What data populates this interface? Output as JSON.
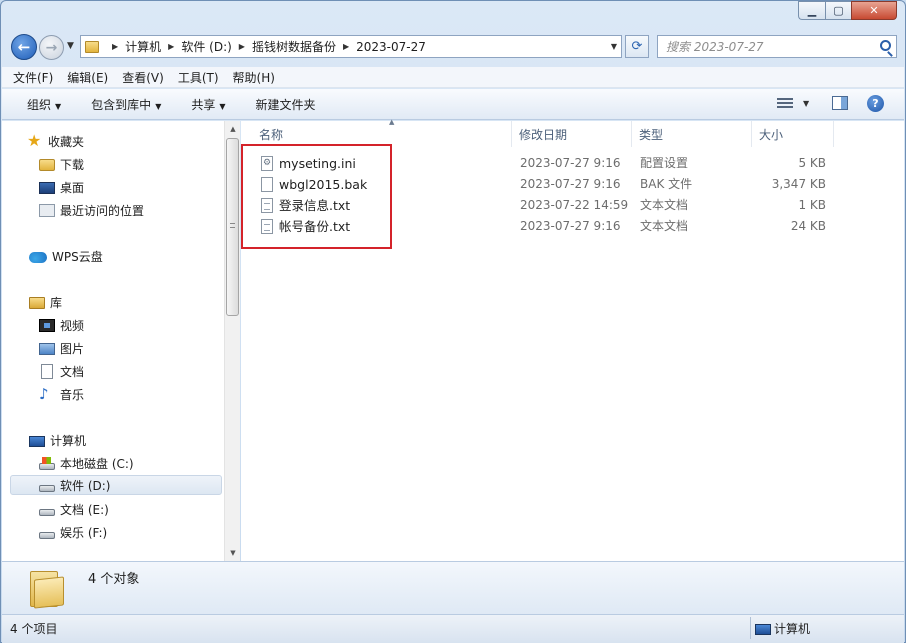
{
  "address": {
    "crumbs": [
      "计算机",
      "软件 (D:)",
      "摇钱树数据备份",
      "2023-07-27"
    ]
  },
  "search": {
    "placeholder": "搜索 2023-07-27"
  },
  "menu": [
    "文件(F)",
    "编辑(E)",
    "查看(V)",
    "工具(T)",
    "帮助(H)"
  ],
  "commands": {
    "organize": "组织",
    "include_library": "包含到库中",
    "share": "共享",
    "new_folder": "新建文件夹"
  },
  "nav": {
    "favorites": "收藏夹",
    "downloads": "下载",
    "desktop": "桌面",
    "recent": "最近访问的位置",
    "wps": "WPS云盘",
    "libraries": "库",
    "videos": "视频",
    "pictures": "图片",
    "documents": "文档",
    "music": "音乐",
    "computer": "计算机",
    "drive_c": "本地磁盘 (C:)",
    "drive_d": "软件 (D:)",
    "drive_e": "文档 (E:)",
    "drive_f": "娱乐 (F:)"
  },
  "columns": {
    "name": "名称",
    "modified": "修改日期",
    "type": "类型",
    "size": "大小"
  },
  "files": [
    {
      "name": "myseting.ini",
      "modified": "2023-07-27 9:16",
      "type": "配置设置",
      "size": "5 KB",
      "icon": "settings-file-icon"
    },
    {
      "name": "wbgl2015.bak",
      "modified": "2023-07-27 9:16",
      "type": "BAK 文件",
      "size": "3,347 KB",
      "icon": "blank-file-icon"
    },
    {
      "name": "登录信息.txt",
      "modified": "2023-07-22 14:59",
      "type": "文本文档",
      "size": "1 KB",
      "icon": "text-file-icon"
    },
    {
      "name": "帐号备份.txt",
      "modified": "2023-07-27 9:16",
      "type": "文本文档",
      "size": "24 KB",
      "icon": "text-file-icon"
    }
  ],
  "details": {
    "count": "4 个对象"
  },
  "status": {
    "items": "4 个项目",
    "location": "计算机"
  },
  "colors": {
    "highlight_box": "#d4232a",
    "accent": "#2b5faa"
  }
}
